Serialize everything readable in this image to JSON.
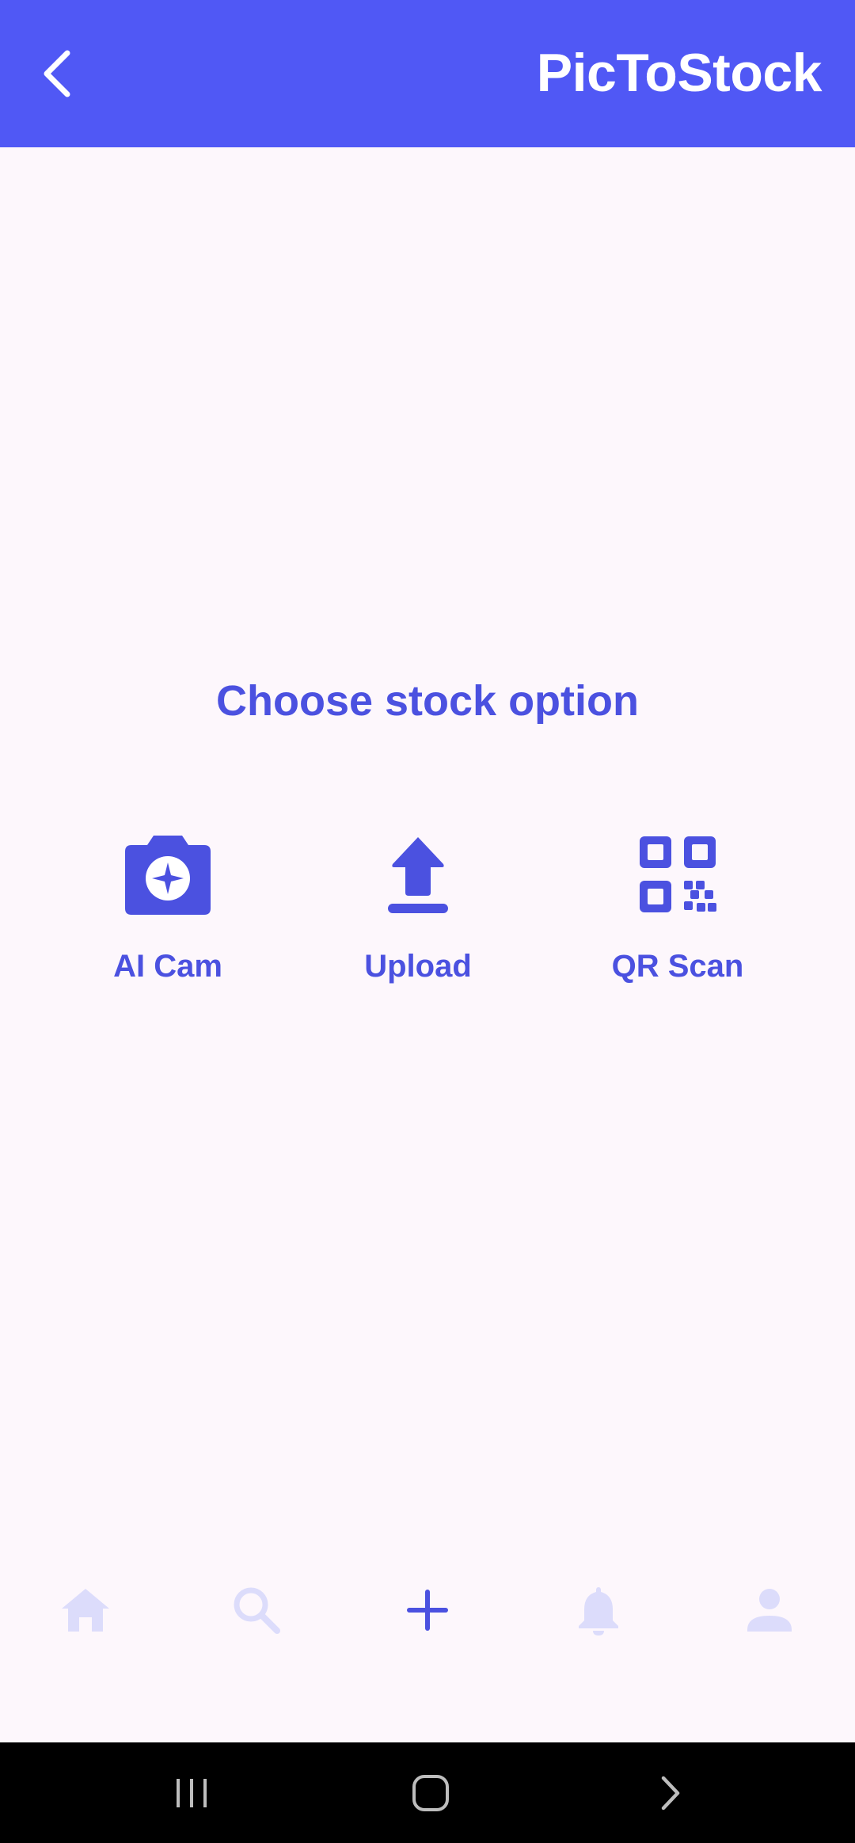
{
  "app": {
    "title": "PicToStock",
    "back_icon": "chevron-left-icon",
    "brand_color": "#5058f5"
  },
  "main": {
    "heading": "Choose stock option",
    "accent_color": "#4b51e0",
    "options": [
      {
        "label": "AI Cam",
        "icon": "ai-camera-icon"
      },
      {
        "label": "Upload",
        "icon": "upload-icon"
      },
      {
        "label": "QR Scan",
        "icon": "qr-code-icon"
      }
    ]
  },
  "bottom_nav": {
    "items": [
      {
        "icon": "home-icon",
        "active": false
      },
      {
        "icon": "search-icon",
        "active": false
      },
      {
        "icon": "add-icon",
        "active": true
      },
      {
        "icon": "bell-icon",
        "active": false
      },
      {
        "icon": "profile-icon",
        "active": false
      }
    ],
    "inactive_color": "#dcdcfb",
    "active_color": "#4b51e0"
  },
  "system_nav": {
    "buttons": [
      "recent-apps-icon",
      "home-button-icon",
      "back-arrow-icon"
    ]
  }
}
